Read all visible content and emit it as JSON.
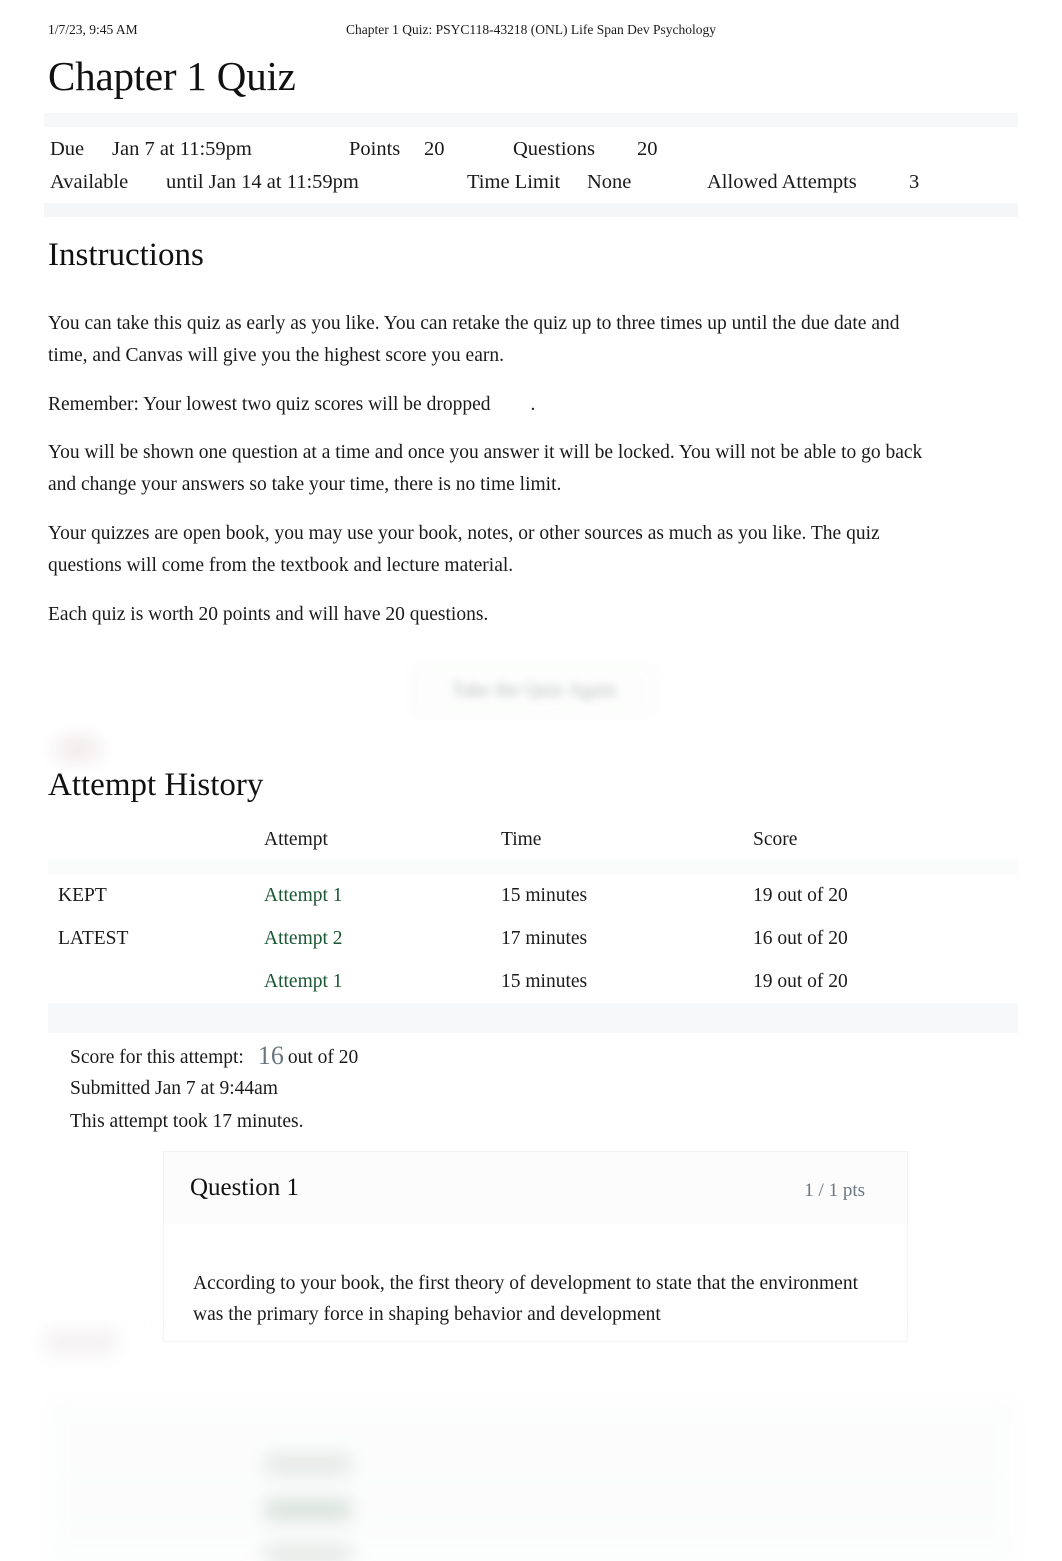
{
  "print_header": {
    "date": "1/7/23, 9:45 AM",
    "title": "Chapter 1 Quiz: PSYC118-43218 (ONL) Life Span Dev Psychology"
  },
  "page_title": "Chapter 1 Quiz",
  "quiz_details": {
    "due_label": "Due",
    "due_value": "Jan 7 at 11:59pm",
    "points_label": "Points",
    "points_value": "20",
    "questions_label": "Questions",
    "questions_value": "20",
    "available_label": "Available",
    "available_value": "until Jan 14 at 11:59pm",
    "time_limit_label": "Time Limit",
    "time_limit_value": "None",
    "allowed_attempts_label": "Allowed Attempts",
    "allowed_attempts_value": "3"
  },
  "instructions": {
    "heading": "Instructions",
    "paragraphs": [
      "You can take this quiz as early as you like. You can retake the quiz up to three times up until the due date and time, and Canvas will give you the highest score you earn.",
      "You will be shown one question at a time and once you answer it will be locked. You will not be able to go back and change your answers so take your time, there is no time limit.",
      "Your quizzes are open book, you may use your book, notes, or other sources as much as you like. The quiz questions will come from the textbook and lecture material.",
      "Each quiz is worth 20 points and will have 20 questions."
    ],
    "remember_text": "Remember: Your lowest two quiz scores will be dropped",
    "remember_trailing": "."
  },
  "take_quiz_again": {
    "label": "Take the Quiz Again"
  },
  "attempt_history": {
    "heading": "Attempt History",
    "columns": {
      "status": "",
      "attempt": "Attempt",
      "time": "Time",
      "score": "Score"
    },
    "rows": [
      {
        "status": "KEPT",
        "attempt": "Attempt 1",
        "time": "15 minutes",
        "score": "19 out of 20"
      },
      {
        "status": "LATEST",
        "attempt": "Attempt 2",
        "time": "17 minutes",
        "score": "16 out of 20"
      },
      {
        "status": "",
        "attempt": "Attempt 1",
        "time": "15 minutes",
        "score": "19 out of 20"
      }
    ]
  },
  "score_summary": {
    "score_label": "Score for this attempt:",
    "score_value": "16",
    "score_out_of": "out of 20",
    "submitted": "Submitted Jan 7 at 9:44am",
    "duration": "This attempt took 17 minutes."
  },
  "question": {
    "title": "Question 1",
    "points": "1 / 1 pts",
    "text": "According to your book, the first theory of development to state that the environment was the primary force in shaping behavior and development"
  },
  "colors": {
    "link_green": "#1a5631",
    "text": "#1a1a1a",
    "muted": "#6b7780",
    "band": "#f7f8f9"
  }
}
